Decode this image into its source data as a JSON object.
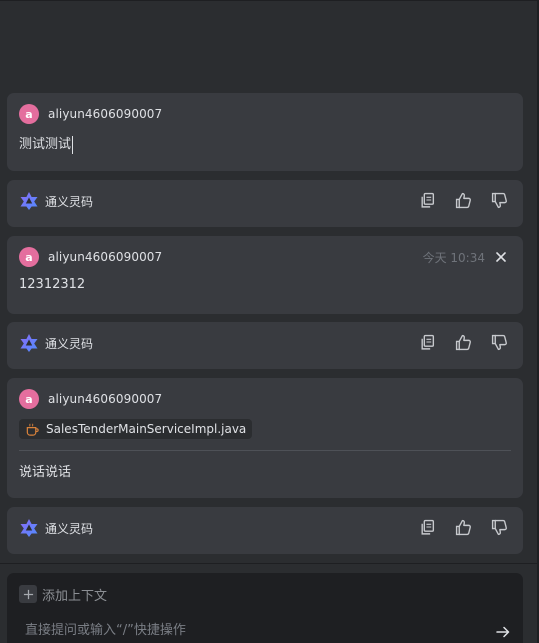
{
  "colors": {
    "background": "#2b2d30",
    "card": "#393b40",
    "input_panel": "#1e1f22",
    "avatar": "#e46e9e",
    "text": "#dfe1e5",
    "muted": "#6f737a",
    "ai_logo_gradient": [
      "#7b6cf6",
      "#5b8cff"
    ]
  },
  "conversation": [
    {
      "role": "user",
      "avatar_letter": "a",
      "username": "aliyun4606090007",
      "text": "测试测试"
    },
    {
      "role": "assistant",
      "name": "通义灵码",
      "logo_icon": "tongyi-logo-icon",
      "actions": [
        "copy-icon",
        "thumbs-up-icon",
        "thumbs-down-icon"
      ]
    },
    {
      "role": "user",
      "avatar_letter": "a",
      "username": "aliyun4606090007",
      "timestamp": "今天 10:34",
      "close_icon": "close-icon",
      "text": "12312312"
    },
    {
      "role": "assistant",
      "name": "通义灵码",
      "logo_icon": "tongyi-logo-icon",
      "actions": [
        "copy-icon",
        "thumbs-up-icon",
        "thumbs-down-icon"
      ]
    },
    {
      "role": "user",
      "avatar_letter": "a",
      "username": "aliyun4606090007",
      "attachment": {
        "icon": "java-file-icon",
        "filename": "SalesTenderMainServiceImpl.java"
      },
      "text": "说话说话"
    },
    {
      "role": "assistant",
      "name": "通义灵码",
      "logo_icon": "tongyi-logo-icon",
      "actions": [
        "copy-icon",
        "thumbs-up-icon",
        "thumbs-down-icon"
      ]
    }
  ],
  "composer": {
    "add_context_label": "添加上下文",
    "add_icon": "plus-icon",
    "placeholder": "直接提问或输入“/”快捷操作",
    "value": "",
    "send_icon": "arrow-right-icon"
  }
}
